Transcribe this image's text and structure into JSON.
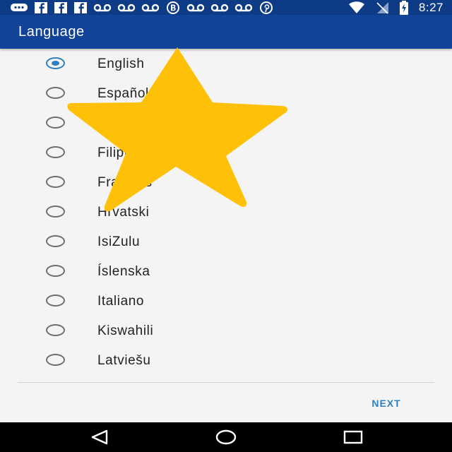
{
  "status_bar": {
    "time": "8:27",
    "notification_icons": [
      "chat-bubble-icon",
      "facebook-icon",
      "facebook-icon",
      "facebook-icon",
      "voicemail-icon",
      "voicemail-icon",
      "voicemail-icon",
      "b-circle-icon",
      "voicemail-icon",
      "voicemail-icon",
      "voicemail-icon",
      "pinterest-icon"
    ],
    "system_icons": [
      "wifi-icon",
      "no-signal-icon",
      "battery-charging-icon"
    ]
  },
  "app_bar": {
    "title": "Language"
  },
  "languages": [
    {
      "label": "English",
      "selected": true
    },
    {
      "label": "Español",
      "selected": false
    },
    {
      "label": "",
      "selected": false
    },
    {
      "label": "Filipino",
      "selected": false
    },
    {
      "label": "Français",
      "selected": false
    },
    {
      "label": "Hrvatski",
      "selected": false
    },
    {
      "label": "IsiZulu",
      "selected": false
    },
    {
      "label": "Íslenska",
      "selected": false
    },
    {
      "label": "Italiano",
      "selected": false
    },
    {
      "label": "Kiswahili",
      "selected": false
    },
    {
      "label": "Latviešu",
      "selected": false
    }
  ],
  "footer": {
    "next_label": "NEXT"
  },
  "overlay": {
    "icon": "star-icon",
    "color": "#ffc107"
  },
  "colors": {
    "app_bar": "#114399",
    "status_bar": "#0d3b86",
    "accent": "#2d7fbf"
  },
  "nav_bar": {
    "icons": [
      "back-icon",
      "home-icon",
      "recents-icon"
    ]
  }
}
